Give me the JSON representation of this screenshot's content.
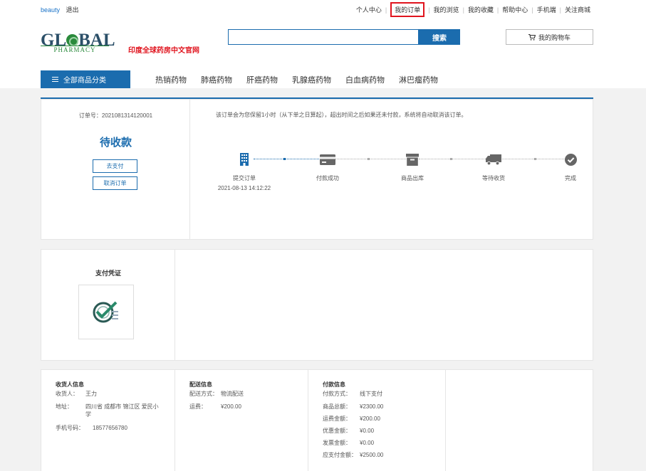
{
  "topbar": {
    "user": "beauty",
    "logout": "退出",
    "links": [
      "个人中心",
      "我的订单",
      "我的浏览",
      "我的收藏",
      "帮助中心",
      "手机端",
      "关注商城"
    ]
  },
  "header": {
    "logo_top": "GL",
    "logo_top_rest": "BAL",
    "logo_bottom": "PHARMACY",
    "slogan": "印度全球药房中文官网",
    "search_placeholder": "",
    "search_button": "搜索",
    "cart": "我的购物车"
  },
  "nav": {
    "all_categories": "全部商品分类",
    "items": [
      "热销药物",
      "肺癌药物",
      "肝癌药物",
      "乳腺癌药物",
      "白血病药物",
      "淋巴瘤药物"
    ]
  },
  "order": {
    "order_no_label": "订单号：",
    "order_no": "2021081314120001",
    "status": "待收款",
    "pay_button": "去支付",
    "cancel_button": "取消订单",
    "notice": "该订单会为您保留1小时（从下单之日算起），超出时间之后如果还未付款，系统将自动取消该订单。",
    "steps": [
      {
        "label": "提交订单",
        "time": "2021-08-13 14:12:22",
        "icon": "building-icon"
      },
      {
        "label": "付款成功",
        "time": "",
        "icon": "card-icon"
      },
      {
        "label": "商品出库",
        "time": "",
        "icon": "box-icon"
      },
      {
        "label": "等待收货",
        "time": "",
        "icon": "truck-icon"
      },
      {
        "label": "完成",
        "time": "",
        "icon": "check-circle-icon"
      }
    ]
  },
  "voucher": {
    "title": "支付凭证"
  },
  "receiver": {
    "title": "收货人信息",
    "name_label": "收货人：",
    "name": "王力",
    "address_label": "地址：",
    "address": "四川省 成都市 锦江区 爱民小学",
    "phone_label": "手机号码：",
    "phone": "18577656780"
  },
  "delivery": {
    "title": "配送信息",
    "method_label": "配送方式：",
    "method": "物流配送",
    "fee_label": "运费：",
    "fee": "¥200.00"
  },
  "payment": {
    "title": "付款信息",
    "rows": [
      {
        "k": "付款方式：",
        "v": "线下支付"
      },
      {
        "k": "商品总额：",
        "v": "¥2300.00"
      },
      {
        "k": "运费金额：",
        "v": "¥200.00"
      },
      {
        "k": "优惠金额：",
        "v": "¥0.00"
      },
      {
        "k": "发票金额：",
        "v": "¥0.00"
      },
      {
        "k": "应支付金额：",
        "v": "¥2500.00"
      }
    ]
  },
  "colors": {
    "primary": "#1b6cae",
    "accent_red": "#e0141e",
    "logo_green": "#2a8a3c",
    "bg_grey": "#f2f2f2"
  }
}
